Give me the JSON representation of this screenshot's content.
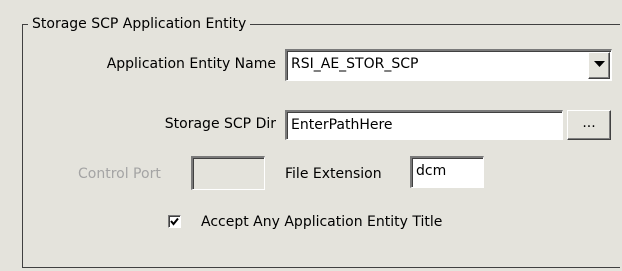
{
  "group": {
    "title": "Storage SCP Application Entity"
  },
  "ae_name": {
    "label": "Application Entity Name",
    "value": "RSI_AE_STOR_SCP"
  },
  "scp_dir": {
    "label": "Storage SCP Dir",
    "value": "EnterPathHere",
    "browse_label": "..."
  },
  "control_port": {
    "label": "Control Port",
    "value": ""
  },
  "file_ext": {
    "label": "File Extension",
    "value": "dcm"
  },
  "accept_any": {
    "label": "Accept Any Application Entity Title",
    "checked": true
  },
  "icons": {
    "combo_arrow": "chevron-down-icon",
    "checkmark": "checkmark-icon"
  }
}
